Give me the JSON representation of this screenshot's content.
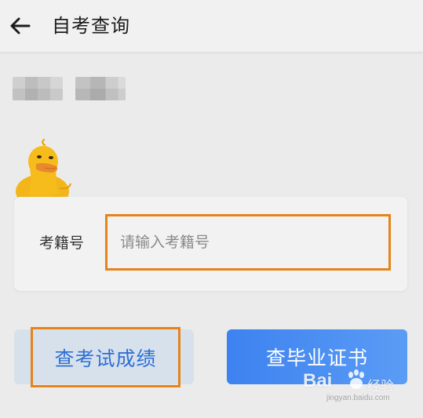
{
  "appbar": {
    "title": "自考查询",
    "back_icon": "arrow-left-icon"
  },
  "form": {
    "field_label": "考籍号",
    "field_placeholder": "请输入考籍号",
    "field_value": ""
  },
  "actions": {
    "query_score_label": "查考试成绩",
    "query_certificate_label": "查毕业证书"
  },
  "watermark": {
    "brand": "Bai",
    "sub": "经验",
    "url": "jingyan.baidu.com"
  },
  "colors": {
    "highlight_frame": "#e6831a",
    "primary_blue": "#3d82f0",
    "score_text_blue": "#2f6fd6",
    "score_button_bg": "#d6e1ec"
  }
}
